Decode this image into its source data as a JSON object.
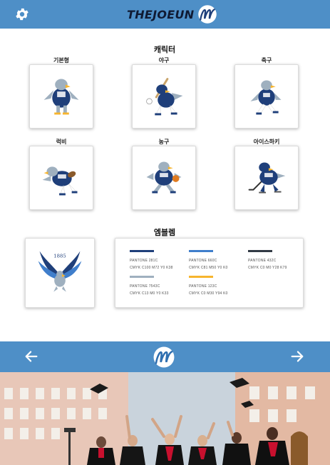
{
  "header": {
    "brand_text": "THEJOEUN",
    "settings_icon": "gear-icon",
    "logo_icon": "m-logo-icon"
  },
  "characters": {
    "title": "캐릭터",
    "items": [
      {
        "label": "기본형",
        "pose": "basic"
      },
      {
        "label": "야구",
        "pose": "baseball"
      },
      {
        "label": "축구",
        "pose": "soccer"
      },
      {
        "label": "럭비",
        "pose": "rugby"
      },
      {
        "label": "농구",
        "pose": "basketball"
      },
      {
        "label": "아이스하키",
        "pose": "hockey"
      }
    ]
  },
  "emblem": {
    "title": "엠블렘",
    "year": "1885",
    "palette": [
      {
        "pantone": "PANTONE  281C",
        "cmyk": "CMYK  C100 M72 Y0 K38",
        "color": "#1f3f7a"
      },
      {
        "pantone": "PANTONE  660C",
        "cmyk": "CMYK  C81 M50 Y0 K0",
        "color": "#3f7ecb"
      },
      {
        "pantone": "PANTONE  432C",
        "cmyk": "CMYK  C0 M0 Y28 K79",
        "color": "#323a45"
      },
      {
        "pantone": "PANTONE  7543C",
        "cmyk": "CMYK  C13 M0 Y0 K33",
        "color": "#9fb0bf"
      },
      {
        "pantone": "PANTONE  123C",
        "cmyk": "CMYK  C0 M30 Y94 K0",
        "color": "#f7b52e"
      }
    ]
  },
  "nav": {
    "prev_icon": "arrow-left-icon",
    "next_icon": "arrow-right-icon",
    "logo_icon": "m-logo-icon"
  },
  "banner": {
    "image": "graduation-photo"
  },
  "colors": {
    "primary": "#4e8fc7",
    "mascot_navy": "#1f3f7a",
    "mascot_gray": "#9fb0bf",
    "mascot_gold": "#f7b52e"
  }
}
